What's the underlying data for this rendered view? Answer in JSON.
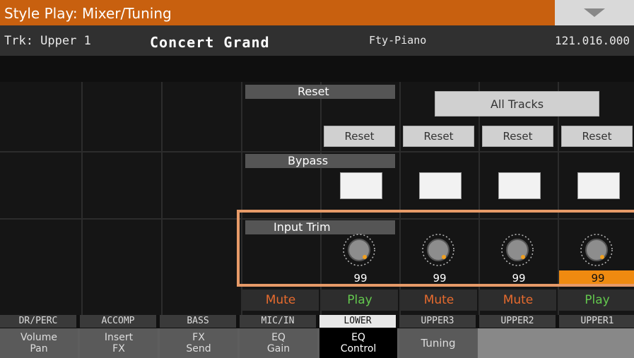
{
  "title": "Style Play: Mixer/Tuning",
  "menu_icon": "chevron-down-icon",
  "info": {
    "track": "Trk: Upper 1",
    "sound": "Concert Grand",
    "bank": "Fty-Piano",
    "program": "121.016.000"
  },
  "reset": {
    "header": "Reset",
    "all_tracks": "All Tracks",
    "button_label": "Reset"
  },
  "bypass": {
    "header": "Bypass"
  },
  "input_trim": {
    "header": "Input Trim",
    "values": [
      "99",
      "99",
      "99",
      "99"
    ]
  },
  "mute_play": [
    "Mute",
    "Play",
    "Mute",
    "Mute",
    "Play"
  ],
  "channels": [
    "DR/PERC",
    "ACCOMP",
    "BASS",
    "MIC/IN",
    "LOWER",
    "UPPER3",
    "UPPER2",
    "UPPER1"
  ],
  "tabs": [
    {
      "line1": "Volume",
      "line2": "Pan"
    },
    {
      "line1": "Insert",
      "line2": "FX"
    },
    {
      "line1": "FX",
      "line2": "Send"
    },
    {
      "line1": "EQ",
      "line2": "Gain"
    },
    {
      "line1": "EQ",
      "line2": "Control"
    },
    {
      "line1": "Tuning",
      "line2": ""
    }
  ],
  "colors": {
    "accent": "#c8600f",
    "selected": "#ef8a10",
    "mute": "#e76b2e",
    "play": "#63c84e",
    "highlight": "#e69a68"
  }
}
